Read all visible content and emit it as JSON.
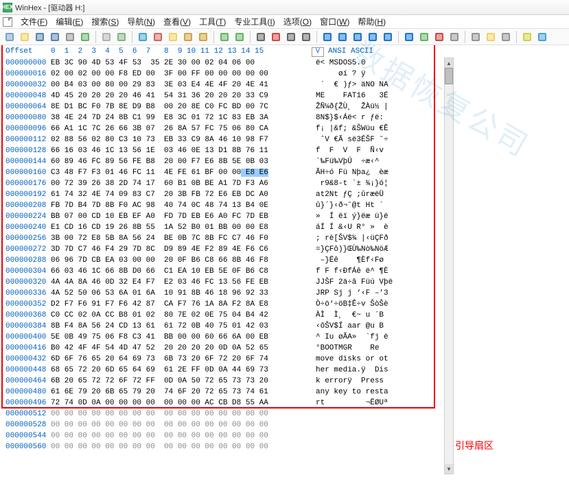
{
  "window": {
    "title": "WinHex - [驱动器 H:]",
    "app_icon_text": "HEX"
  },
  "menu": {
    "items": [
      {
        "label": "文件",
        "accel": "F"
      },
      {
        "label": "编辑",
        "accel": "E"
      },
      {
        "label": "搜索",
        "accel": "S"
      },
      {
        "label": "导航",
        "accel": "N"
      },
      {
        "label": "查看",
        "accel": "V"
      },
      {
        "label": "工具",
        "accel": "T"
      },
      {
        "label": "专业工具",
        "accel": "I"
      },
      {
        "label": "选项",
        "accel": "O"
      },
      {
        "label": "窗口",
        "accel": "W"
      },
      {
        "label": "帮助",
        "accel": "H"
      }
    ]
  },
  "toolbar_icons": [
    "new-file",
    "open-folder",
    "save",
    "save-as",
    "print",
    "properties",
    "sep",
    "open-disk",
    "open-ram",
    "sep",
    "undo",
    "cut",
    "copy",
    "paste",
    "clipboard",
    "sep",
    "find-text",
    "find-hex",
    "sep",
    "binoculars",
    "binoculars-red",
    "binoculars-down",
    "binoculars-up",
    "sep",
    "goto-start",
    "goto-prev",
    "arrow-right",
    "goto-next",
    "goto-end",
    "sep",
    "gear-blue",
    "gear-green",
    "play",
    "eject",
    "sep",
    "search-magnifier",
    "camera",
    "calculator",
    "sep",
    "cogs",
    "info"
  ],
  "header": {
    "offset": "Offset",
    "bytecols": "0  1  2  3  4  5  6  7   8  9 10 11 12 13 14 15",
    "v": "V",
    "ascii": "ANSI ASCII"
  },
  "rows": [
    {
      "o": "000000000",
      "b": "EB 3C 90 4D 53 4F 53  35 2E 30 00 02 04 06 00",
      "a": "ë< MSDOS5.0"
    },
    {
      "o": "000000016",
      "b": "02 00 02 00 00 F8 ED 00  3F 00 FF 00 00 00 00 00",
      "a": "     øí ? ÿ"
    },
    {
      "o": "000000032",
      "b": "00 B4 03 00 80 00 29 83  3E 03 E4 4E 4F 20 4E 41",
      "a": " ´  € )ƒ> äNO NA"
    },
    {
      "o": "000000048",
      "b": "4D 45 20 20 20 20 46 41  54 31 36 20 20 20 33 C9",
      "a": "ME    FAT16   3É"
    },
    {
      "o": "000000064",
      "b": "8E D1 BC F0 7B 8E D9 B8  00 20 8E C0 FC BD 00 7C",
      "a": "ŽÑ¼ð{ŽÙ¸  ŽÀü½ |"
    },
    {
      "o": "000000080",
      "b": "38 4E 24 7D 24 8B C1 99  E8 3C 01 72 1C 83 EB 3A",
      "a": "8N$}$‹Áë< r ƒë:"
    },
    {
      "o": "000000096",
      "b": "66 A1 1C 7C 26 66 3B 07  26 8A 57 FC 75 06 80 CA",
      "a": "f¡ |&f; &ŠWüu €Ê"
    },
    {
      "o": "000000112",
      "b": "02 88 56 02 80 C3 10 73  EB 33 C9 8A 46 10 98 F7",
      "a": " ˆV €Ã së3ÉŠF ˜÷"
    },
    {
      "o": "000000128",
      "b": "66 16 03 46 1C 13 56 1E  03 46 0E 13 D1 8B 76 11",
      "a": "f  F  V  F  Ñ‹v"
    },
    {
      "o": "000000144",
      "b": "60 89 46 FC 89 56 FE B8  20 00 F7 E6 8B 5E 0B 03",
      "a": "`‰Fü‰VþÚ  ÷æ‹^"
    },
    {
      "o": "000000160",
      "b": "C3 48 F7 F3 01 46 FC 11  4E FE 61 BF 00 00 E8 E6",
      "a": "ÃH÷ó Fü Nþa¿  èæ"
    },
    {
      "o": "000000176",
      "b": "00 72 39 26 38 2D 74 17  60 B1 0B BE A1 7D F3 A6",
      "a": " r9&8-t `± ¾¡}ó¦"
    },
    {
      "o": "000000192",
      "b": "61 74 32 4E 74 09 83 C7  20 3B FB 72 E6 EB DC A0",
      "a": "at2Nt ƒÇ ;ûræëÜ "
    },
    {
      "o": "000000208",
      "b": "FB 7D B4 7D 8B F0 AC 98  40 74 0C 48 74 13 B4 0E",
      "a": "û}´}‹ð¬˜@t Ht ´"
    },
    {
      "o": "000000224",
      "b": "BB 07 00 CD 10 EB EF A0  FD 7D EB E6 A0 FC 7D EB",
      "a": "»  Í ëï ý}ëæ ü}ë"
    },
    {
      "o": "000000240",
      "b": "E1 CD 16 CD 19 26 8B 55  1A 52 B0 01 BB 00 00 E8",
      "a": "áÍ Í &‹U R° »  è"
    },
    {
      "o": "000000256",
      "b": "3B 00 72 E8 5B 8A 56 24  BE 0B 7C 8B FC C7 46 F0",
      "a": "; rè[ŠV$¾ |‹üÇFð"
    },
    {
      "o": "000000272",
      "b": "3D 7D C7 46 F4 29 7D 8C  D9 89 4E F2 89 4E F6 C6",
      "a": "=}ÇFô)}ŒÙ‰Nò‰NöÆ"
    },
    {
      "o": "000000288",
      "b": "06 96 7D CB EA 03 00 00  20 0F B6 C8 66 8B 46 F8",
      "a": " –}Ëê    ¶Èf‹Fø"
    },
    {
      "o": "000000304",
      "b": "66 03 46 1C 66 8B D0 66  C1 EA 10 EB 5E 0F B6 C8",
      "a": "f F f‹ÐfÁê ë^ ¶È"
    },
    {
      "o": "000000320",
      "b": "4A 4A 8A 46 0D 32 E4 F7  E2 03 46 FC 13 56 FE EB",
      "a": "JJŠF 2ä÷â Füú Vþë"
    },
    {
      "o": "000000336",
      "b": "4A 52 50 06 53 6A 01 6A  10 91 8B 46 18 96 92 33",
      "a": "JRP Sj j ‘‹F –'3"
    },
    {
      "o": "000000352",
      "b": "D2 F7 F6 91 F7 F6 42 87  CA F7 76 1A 8A F2 8A E8",
      "a": "Ò÷ö‘÷öB‡Ê÷v ŠòŠè"
    },
    {
      "o": "000000368",
      "b": "C0 CC 02 0A CC B8 01 02  80 7E 02 0E 75 04 B4 42",
      "a": "ÀÌ  Ì¸  €~ u ´B"
    },
    {
      "o": "000000384",
      "b": "8B F4 8A 56 24 CD 13 61  61 72 0B 40 75 01 42 03",
      "a": "‹ôŠV$Í aar @u B"
    },
    {
      "o": "000000400",
      "b": "5E 0B 49 75 06 F8 C3 41  BB 00 00 60 66 6A 00 EB",
      "a": "^ Iu øÃA»  `fj ë"
    },
    {
      "o": "000000416",
      "b": "B0 42 4F 4F 54 4D 47 52  20 20 20 20 0D 0A 52 65",
      "a": "°BOOTMGR    Re"
    },
    {
      "o": "000000432",
      "b": "6D 6F 76 65 20 64 69 73  6B 73 20 6F 72 20 6F 74",
      "a": "move disks or ot"
    },
    {
      "o": "000000448",
      "b": "68 65 72 20 6D 65 64 69  61 2E FF 0D 0A 44 69 73",
      "a": "her media.ÿ  Dis"
    },
    {
      "o": "000000464",
      "b": "6B 20 65 72 72 6F 72 FF  0D 0A 50 72 65 73 73 20",
      "a": "k errorÿ  Press "
    },
    {
      "o": "000000480",
      "b": "61 6E 79 20 6B 65 79 20  74 6F 20 72 65 73 74 61",
      "a": "any key to resta"
    },
    {
      "o": "000000496",
      "b": "72 74 0D 0A 00 00 00 00  00 00 00 AC CB D8 55 AA",
      "a": "rt         ¬ËØUª"
    },
    {
      "o": "000000512",
      "b": "00 00 00 00 00 00 00 00  00 00 00 00 00 00 00 00",
      "a": ""
    },
    {
      "o": "000000528",
      "b": "00 00 00 00 00 00 00 00  00 00 00 00 00 00 00 00",
      "a": ""
    },
    {
      "o": "000000544",
      "b": "00 00 00 00 00 00 00 00  00 00 00 00 00 00 00 00",
      "a": ""
    },
    {
      "o": "000000560",
      "b": "00 00 00 00 00 00 00 00  00 00 00 00 00 00 00 00",
      "a": ""
    }
  ],
  "dim_after_index": 32,
  "highlight": {
    "row_index": 10,
    "byte_start": 14
  },
  "annotation": {
    "label": "引导扇区"
  },
  "watermark": "数据恢复公司"
}
